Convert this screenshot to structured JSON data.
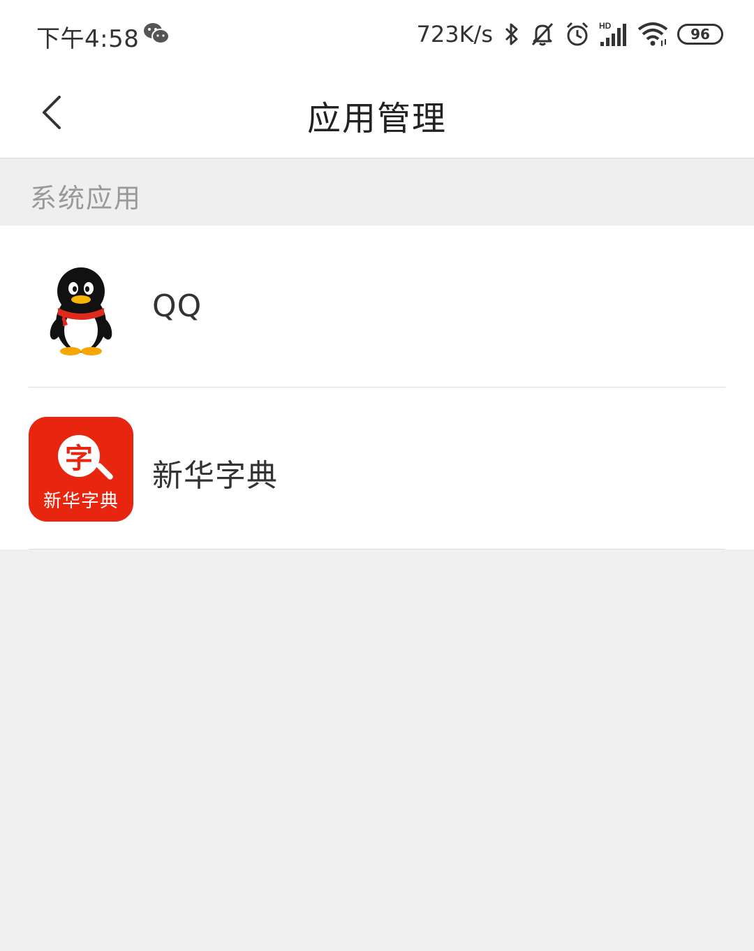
{
  "status_bar": {
    "time": "下午4:58",
    "net_speed": "723K/s",
    "battery_level": "96",
    "icons": [
      "wechat-icon",
      "bluetooth-icon",
      "mute-bell-icon",
      "alarm-icon",
      "hd-signal-icon",
      "wifi-icon",
      "battery-icon"
    ]
  },
  "header": {
    "title": "应用管理",
    "back_icon": "chevron-left-icon"
  },
  "section": {
    "label": "系统应用"
  },
  "apps": [
    {
      "name": "QQ",
      "icon": "qq-penguin-icon"
    },
    {
      "name": "新华字典",
      "icon": "xinhua-dictionary-icon",
      "icon_char": "字",
      "icon_text": "新华字典",
      "icon_color": "#e8250f"
    }
  ],
  "colors": {
    "background": "#f0f0f0",
    "surface": "#ffffff",
    "section_text": "#999999",
    "accent_red": "#e8250f"
  }
}
